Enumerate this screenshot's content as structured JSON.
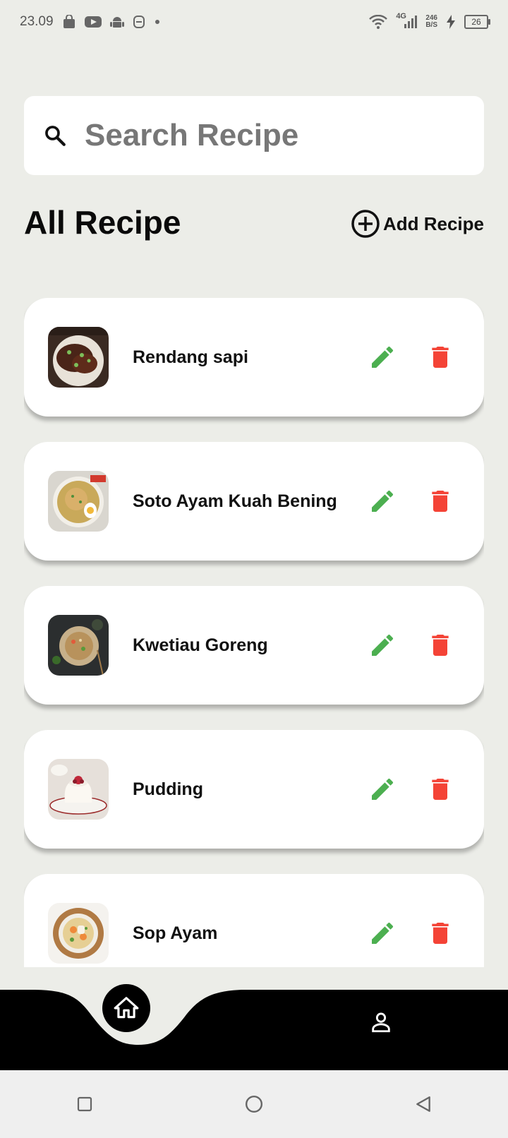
{
  "status_bar": {
    "time": "23.09",
    "network": "4G",
    "net_speed_value": "246",
    "net_speed_unit": "B/S",
    "battery": "26",
    "icons": [
      "shop-icon",
      "youtube-icon",
      "android-icon",
      "vpn-icon",
      "dot-icon",
      "wifi-icon",
      "signal-icon",
      "charging-icon",
      "battery-icon"
    ]
  },
  "search": {
    "placeholder": "Search Recipe",
    "value": ""
  },
  "header": {
    "title": "All Recipe",
    "add_label": "Add Recipe"
  },
  "recipes": [
    {
      "name": "Rendang sapi",
      "thumb": "beef-dish"
    },
    {
      "name": "Soto Ayam Kuah Bening",
      "thumb": "soup-bowl"
    },
    {
      "name": "Kwetiau Goreng",
      "thumb": "noodle-plate"
    },
    {
      "name": "Pudding",
      "thumb": "pudding-dessert"
    },
    {
      "name": "Sop Ayam",
      "thumb": "soup-bowl-2"
    }
  ],
  "colors": {
    "background": "#ECEDE8",
    "card": "#FFFFFF",
    "edit": "#4CAF50",
    "delete": "#F44336",
    "nav": "#000000"
  },
  "bottom_nav": {
    "items": [
      "home-icon",
      "person-icon"
    ],
    "active": "home"
  }
}
